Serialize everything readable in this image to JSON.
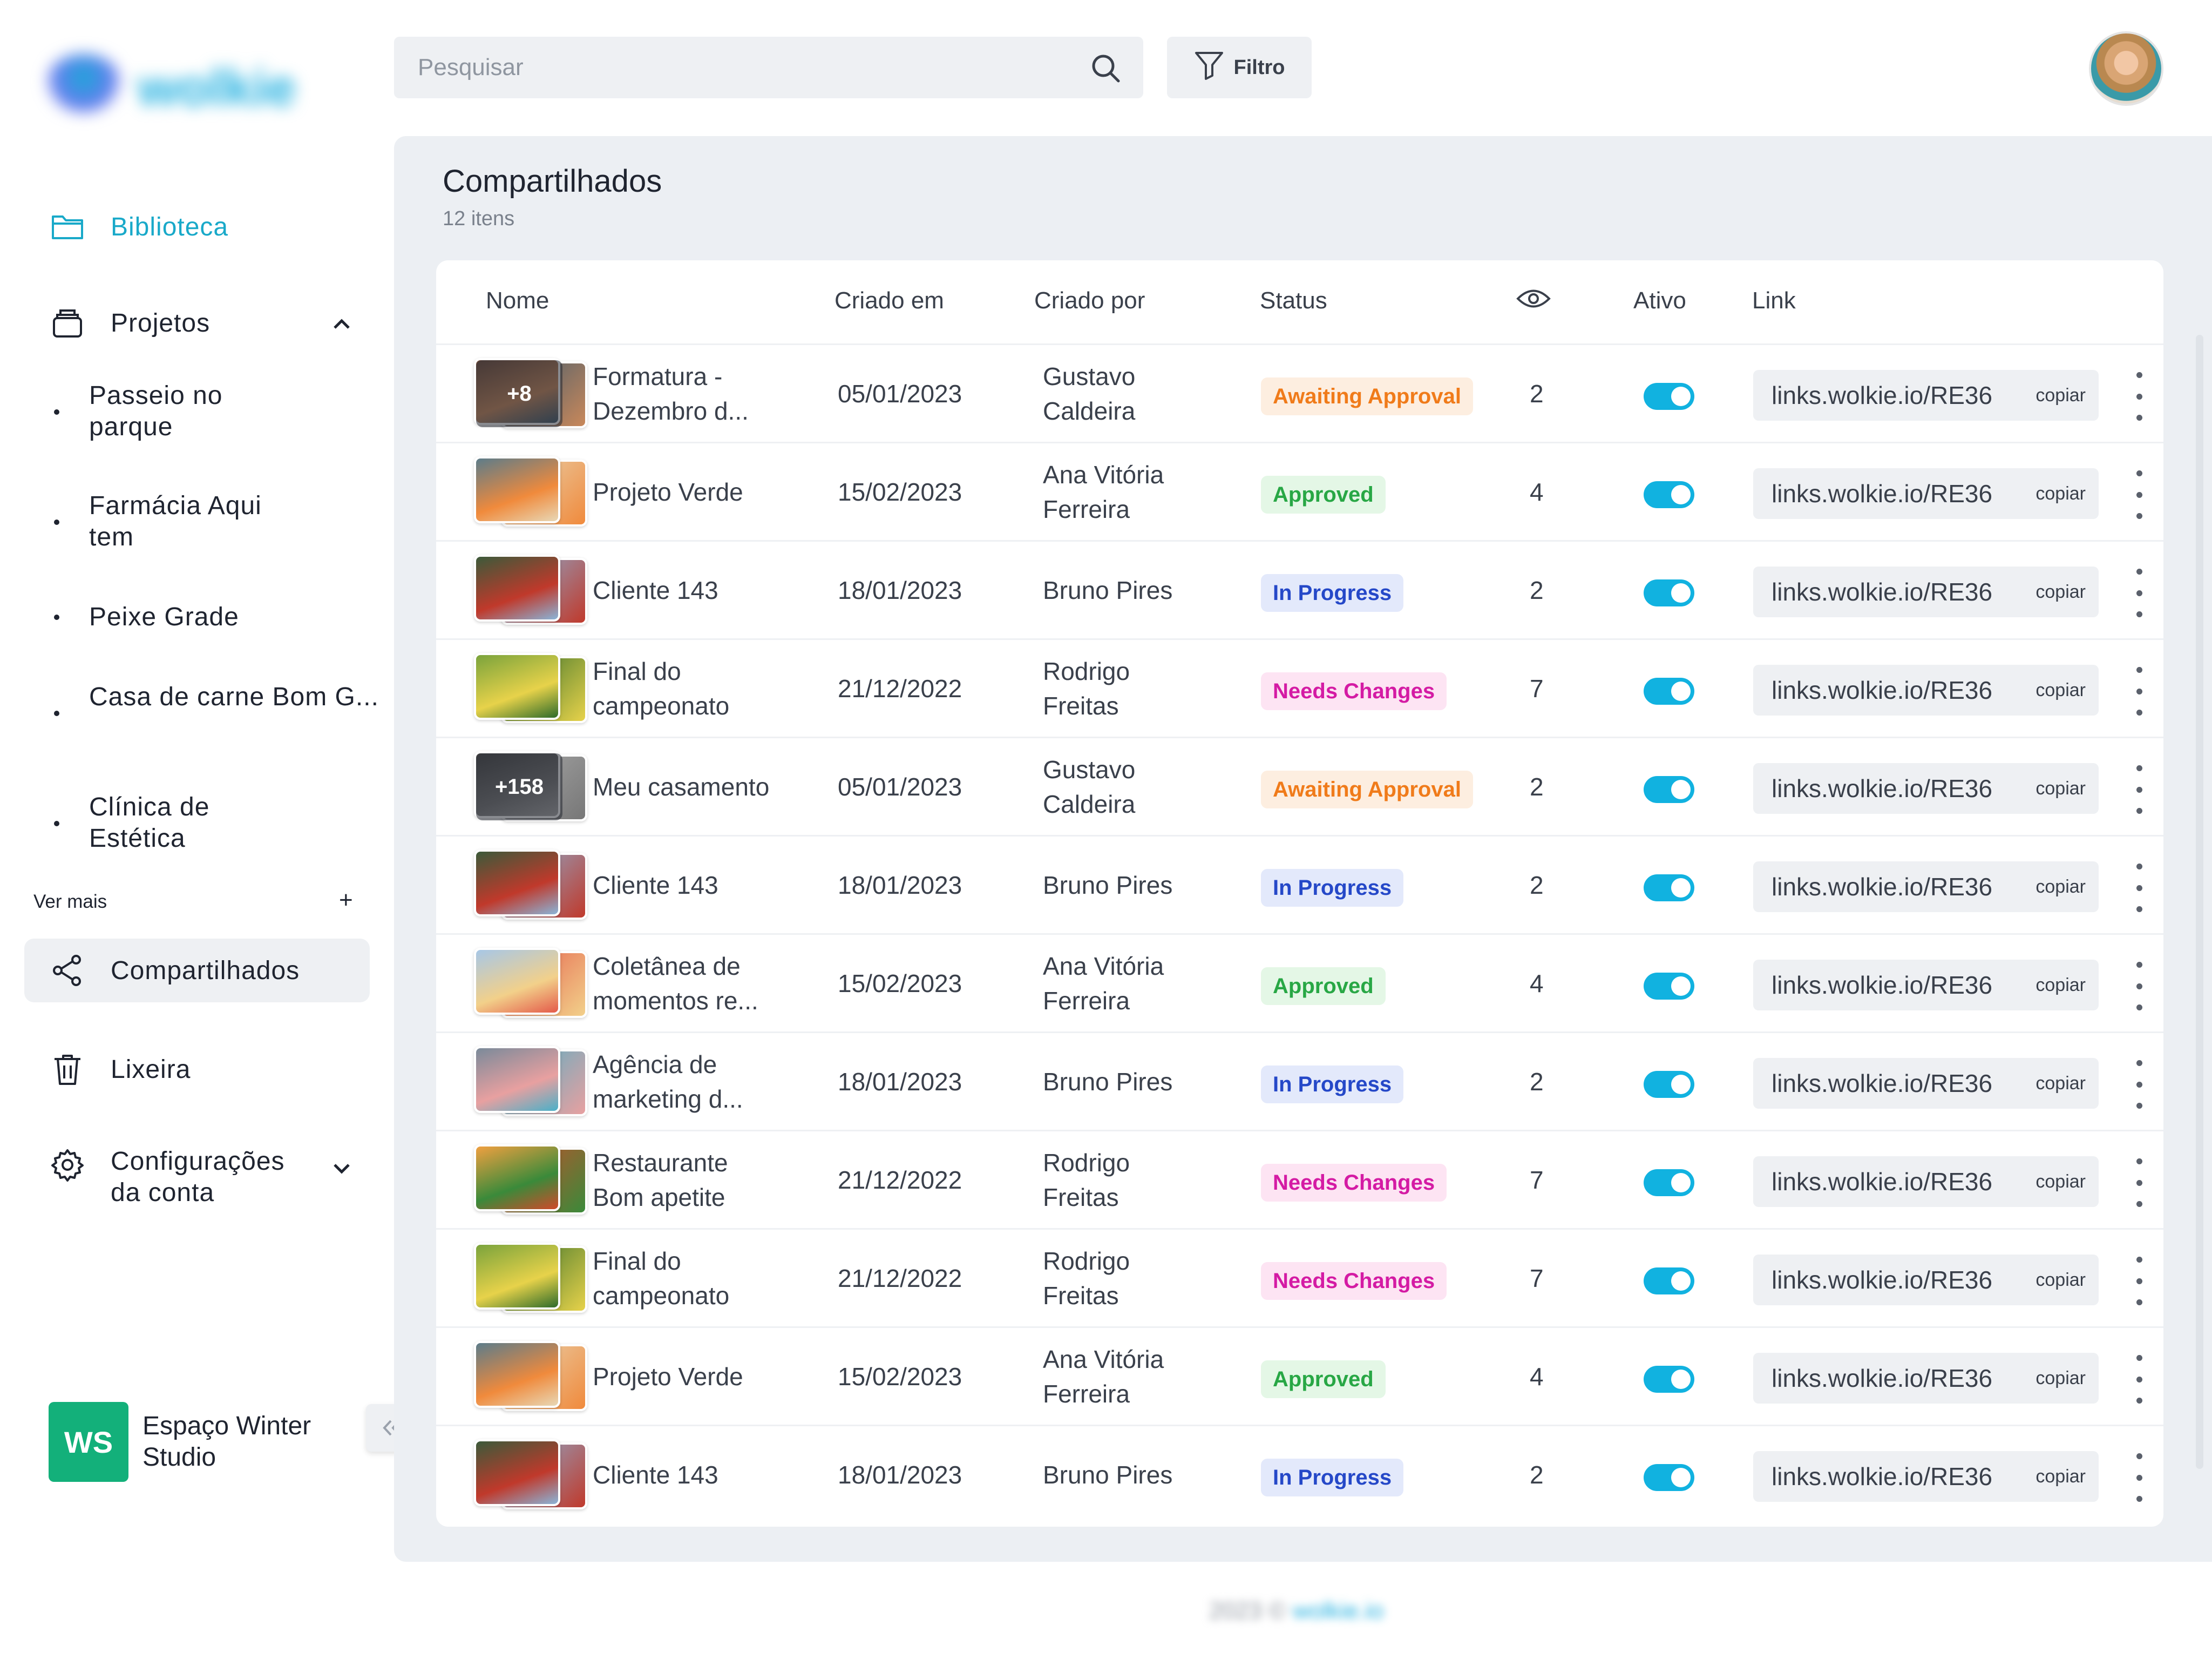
{
  "brand": {
    "name": "wolkie"
  },
  "colors": {
    "accent": "#19a9c9",
    "toggle_on": "#11b2e0",
    "workspace_badge": "#13b07a",
    "panel_bg": "#eceff3"
  },
  "sidebar": {
    "biblioteca": "Biblioteca",
    "projetos": "Projetos",
    "projects": [
      "Passeio no parque",
      "Farmácia Aqui tem",
      "Peixe Grade",
      "Casa de carne Bom G...",
      "Clínica de Estética"
    ],
    "ver_mais": "Ver mais",
    "ver_mais_plus": "+",
    "compartilhados": "Compartilhados",
    "lixeira": "Lixeira",
    "configuracoes": "Configurações da conta"
  },
  "workspace": {
    "initials": "WS",
    "name": "Espaço Winter Studio"
  },
  "search": {
    "placeholder": "Pesquisar"
  },
  "filter": {
    "label": "Filtro"
  },
  "page": {
    "title": "Compartilhados",
    "count": "12 itens"
  },
  "table": {
    "headers": {
      "nome": "Nome",
      "criado_em": "Criado em",
      "criado_por": "Criado por",
      "status": "Status",
      "views_icon": "eye-icon",
      "ativo": "Ativo",
      "link": "Link"
    },
    "copy_label": "copiar",
    "rows": [
      {
        "name": "Formatura - Dezembro d...",
        "date": "05/01/2023",
        "by": "Gustavo Caldeira",
        "status": "Awaiting Approval",
        "views": "2",
        "link": "links.wolkie.io/RE36",
        "thumb_count": "+8",
        "active": true
      },
      {
        "name": "Projeto Verde",
        "date": "15/02/2023",
        "by": "Ana Vitória Ferreira",
        "status": "Approved",
        "views": "4",
        "link": "links.wolkie.io/RE36",
        "thumb_count": "",
        "active": true
      },
      {
        "name": "Cliente 143",
        "date": "18/01/2023",
        "by": "Bruno Pires",
        "status": "In Progress",
        "views": "2",
        "link": "links.wolkie.io/RE36",
        "thumb_count": "",
        "active": true
      },
      {
        "name": "Final do campeonato",
        "date": "21/12/2022",
        "by": "Rodrigo Freitas",
        "status": "Needs Changes",
        "views": "7",
        "link": "links.wolkie.io/RE36",
        "thumb_count": "",
        "active": true
      },
      {
        "name": "Meu casamento",
        "date": "05/01/2023",
        "by": "Gustavo Caldeira",
        "status": "Awaiting Approval",
        "views": "2",
        "link": "links.wolkie.io/RE36",
        "thumb_count": "+158",
        "active": true
      },
      {
        "name": "Cliente 143",
        "date": "18/01/2023",
        "by": "Bruno Pires",
        "status": "In Progress",
        "views": "2",
        "link": "links.wolkie.io/RE36",
        "thumb_count": "",
        "active": true
      },
      {
        "name": "Coletânea de momentos re...",
        "date": "15/02/2023",
        "by": "Ana Vitória Ferreira",
        "status": "Approved",
        "views": "4",
        "link": "links.wolkie.io/RE36",
        "thumb_count": "",
        "active": true
      },
      {
        "name": "Agência de marketing d...",
        "date": "18/01/2023",
        "by": "Bruno Pires",
        "status": "In Progress",
        "views": "2",
        "link": "links.wolkie.io/RE36",
        "thumb_count": "",
        "active": true
      },
      {
        "name": "Restaurante Bom apetite",
        "date": "21/12/2022",
        "by": "Rodrigo Freitas",
        "status": "Needs Changes",
        "views": "7",
        "link": "links.wolkie.io/RE36",
        "thumb_count": "",
        "active": true
      },
      {
        "name": "Final do campeonato",
        "date": "21/12/2022",
        "by": "Rodrigo Freitas",
        "status": "Needs Changes",
        "views": "7",
        "link": "links.wolkie.io/RE36",
        "thumb_count": "",
        "active": true
      },
      {
        "name": "Projeto Verde",
        "date": "15/02/2023",
        "by": "Ana Vitória Ferreira",
        "status": "Approved",
        "views": "4",
        "link": "links.wolkie.io/RE36",
        "thumb_count": "",
        "active": true
      },
      {
        "name": "Cliente 143",
        "date": "18/01/2023",
        "by": "Bruno Pires",
        "status": "In Progress",
        "views": "2",
        "link": "links.wolkie.io/RE36",
        "thumb_count": "",
        "active": true
      }
    ]
  },
  "footer": {
    "year": "2023 ©",
    "link": "wolkie.io"
  }
}
